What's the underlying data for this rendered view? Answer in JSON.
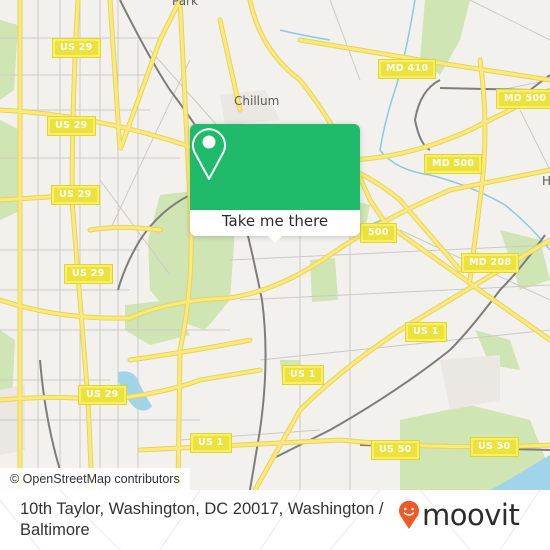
{
  "map": {
    "colors": {
      "land": "#f2f1ed",
      "park": "#cfe5b4",
      "water": "#9fd4ea",
      "major_road": "#f8e473",
      "minor_road": "#c9c6c0",
      "rail": "#7d7d7d",
      "popup_green": "#1fba6a",
      "brand_orange": "#f05a28"
    },
    "place_labels": {
      "park": "Park",
      "chillum": "Chillum",
      "h": "H"
    },
    "shields": [
      {
        "id": "us29-1",
        "label": "US 29"
      },
      {
        "id": "us29-2",
        "label": "US 29"
      },
      {
        "id": "us29-3",
        "label": "US 29"
      },
      {
        "id": "us29-4",
        "label": "US 29"
      },
      {
        "id": "us29-5",
        "label": "US 29"
      },
      {
        "id": "md410",
        "label": "MD 410"
      },
      {
        "id": "md500-1",
        "label": "MD 500"
      },
      {
        "id": "md500-2",
        "label": "MD 500"
      },
      {
        "id": "md500-3",
        "label": "500"
      },
      {
        "id": "md208",
        "label": "MD 208"
      },
      {
        "id": "us1-1",
        "label": "US 1"
      },
      {
        "id": "us1-2",
        "label": "US 1"
      },
      {
        "id": "us1-3",
        "label": "US 1"
      },
      {
        "id": "us50-1",
        "label": "US 50"
      },
      {
        "id": "us50-2",
        "label": "US 50"
      }
    ],
    "attribution": "© OpenStreetMap contributors"
  },
  "popup": {
    "icon": "location-pin-icon",
    "button_label": "Take me there"
  },
  "footer": {
    "address": "10th Taylor, Washington, DC 20017, Washington / Baltimore",
    "brand": "moovit",
    "brand_icon": "moovit-pin-smile-icon"
  }
}
